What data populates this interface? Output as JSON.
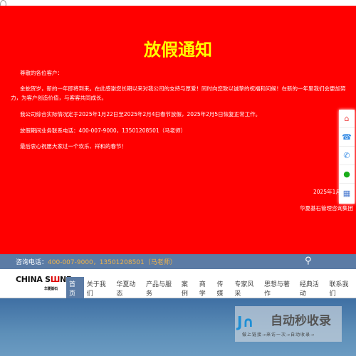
{
  "notice": {
    "title": "放假通知",
    "greeting": "尊敬的各位客户：",
    "para1": "金蛇贺岁，新的一年即将到来。在此感谢您长期以来对我公司的支持与厚爱！同时向您致以诚挚的祝福和问候！在新的一年里我们会更加努力，为客户创造价值，与客客共同成长。",
    "para2": "我公司综合实际情况定于2025年1月22日至2025年2月4日春节放假，2025年2月5日恢复正常工作。",
    "para3": "放假期间业务联系电话：400-007-9000，13501208501（马老师）",
    "para4": "最后衷心祝愿大家过一个欢乐、祥和的春节！",
    "date": "2025年1月2",
    "signature": "华夏基石管理咨询集团"
  },
  "sidebar": {
    "icons": [
      "home-icon",
      "consult-phone-icon",
      "phone-icon",
      "wechat-icon",
      "qrcode-icon"
    ]
  },
  "infobar": {
    "label": "咨询电话：",
    "phones": "400-007-9000，13501208501（马老师）"
  },
  "logo": {
    "text": "CHINA STONE",
    "sub": "华夏基石"
  },
  "menu": [
    "首页",
    "关于我们",
    "华夏动态",
    "产品与服务",
    "案例",
    "商学",
    "传媒",
    "专家风采",
    "思想与著作",
    "经典活动",
    "联系我们"
  ],
  "watermark": {
    "title": "自动秒收录",
    "subtitle": "做上链接→来访一次→自动收录→"
  },
  "colors": {
    "notice_bg": "#ff0000",
    "title": "#ffff00",
    "bar": "#5b7ba5",
    "phone": "#f0b44a"
  }
}
